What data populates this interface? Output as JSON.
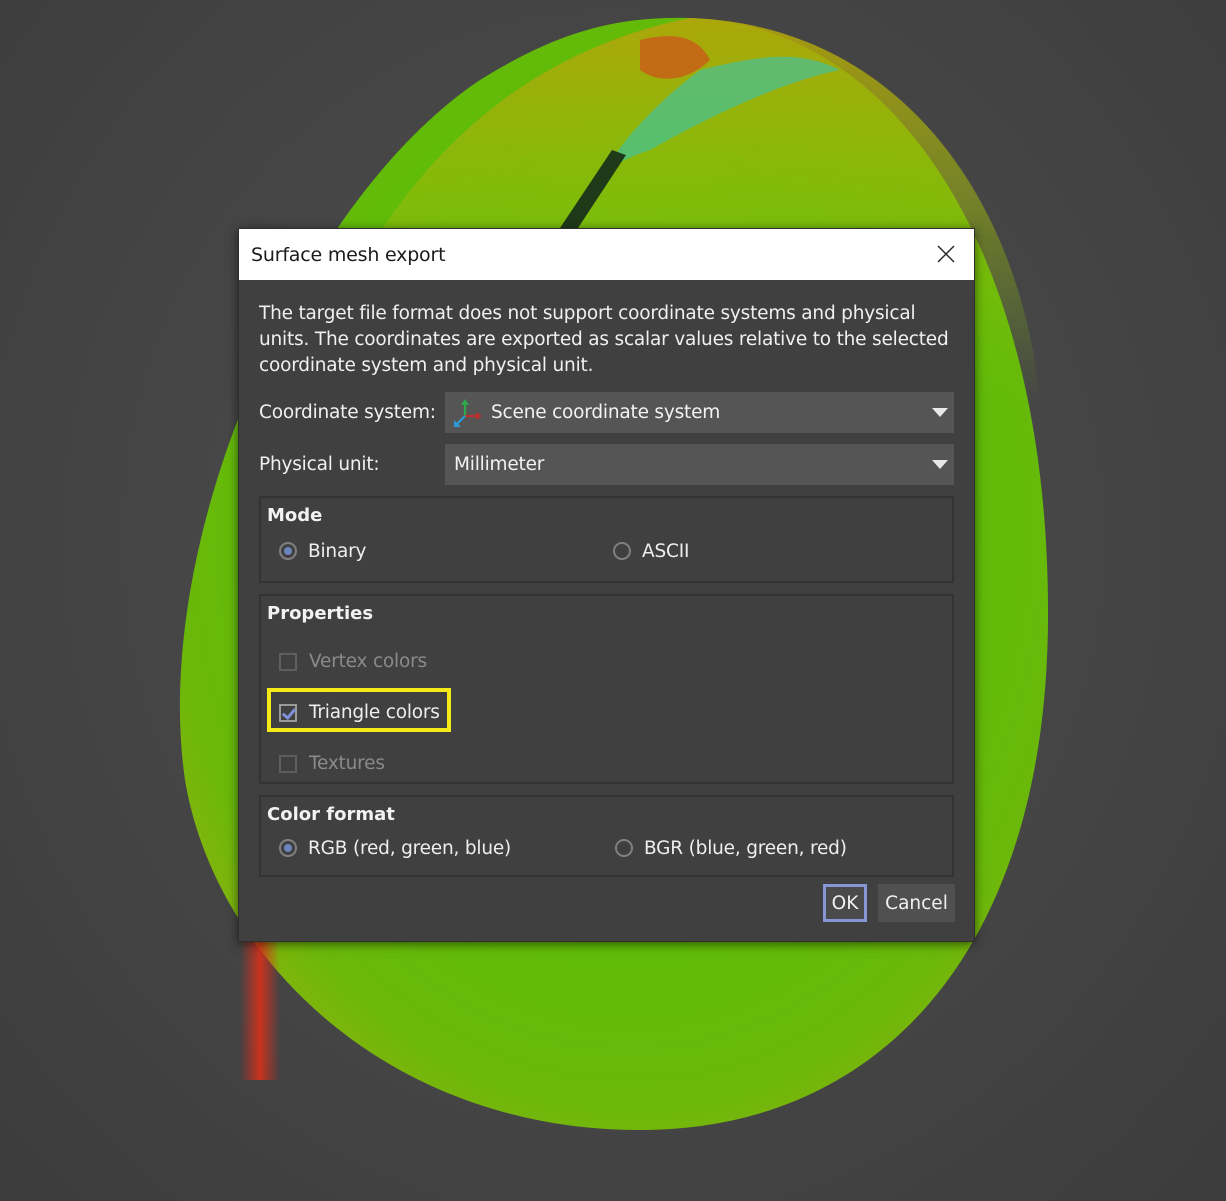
{
  "scene": {
    "background_color": "#474747",
    "object": "colored-surface-mesh-egg"
  },
  "dialog": {
    "title": "Surface mesh export",
    "close_icon": "close-icon",
    "info_text": "The target file format does not support coordinate systems and physical units. The coordinates are exported as scalar values relative to the selected coordinate system and physical unit.",
    "coordinate_system": {
      "label": "Coordinate system:",
      "value": "Scene coordinate system",
      "icon": "coordinate-axes-icon"
    },
    "physical_unit": {
      "label": "Physical unit:",
      "value": "Millimeter"
    },
    "mode": {
      "title": "Mode",
      "options": [
        {
          "label": "Binary",
          "checked": true
        },
        {
          "label": "ASCII",
          "checked": false
        }
      ]
    },
    "properties": {
      "title": "Properties",
      "items": [
        {
          "label": "Vertex colors",
          "checked": false,
          "enabled": false
        },
        {
          "label": "Triangle colors",
          "checked": true,
          "enabled": true,
          "highlighted": true
        },
        {
          "label": "Textures",
          "checked": false,
          "enabled": false
        }
      ]
    },
    "color_format": {
      "title": "Color format",
      "options": [
        {
          "label": "RGB (red, green, blue)",
          "checked": true
        },
        {
          "label": "BGR (blue, green, red)",
          "checked": false
        }
      ]
    },
    "buttons": {
      "ok": "OK",
      "cancel": "Cancel"
    },
    "colors": {
      "accent": "#8796d4",
      "highlight": "#f3ea18"
    }
  }
}
